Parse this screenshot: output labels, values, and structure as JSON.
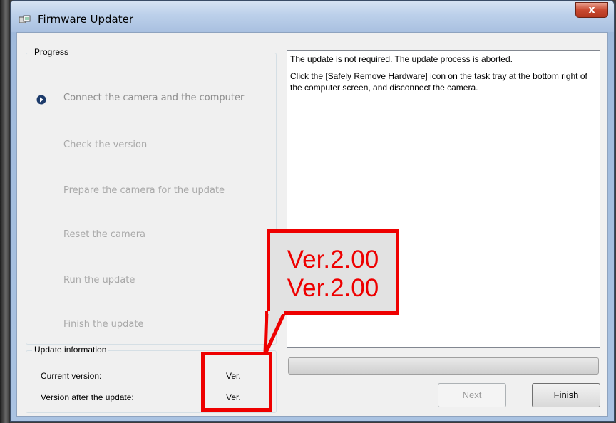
{
  "window": {
    "title": "Firmware Updater",
    "close_label": "x"
  },
  "progress": {
    "group_label": "Progress",
    "steps": [
      {
        "label": "Connect the camera and the computer",
        "active": true
      },
      {
        "label": "Check the version",
        "active": false
      },
      {
        "label": "Prepare the camera for the update",
        "active": false
      },
      {
        "label": "Reset the camera",
        "active": false
      },
      {
        "label": "Run the update",
        "active": false
      },
      {
        "label": "Finish the update",
        "active": false
      }
    ]
  },
  "update_info": {
    "group_label": "Update information",
    "current_version_label": "Current version:",
    "current_version_value": "Ver.",
    "after_version_label": "Version after the update:",
    "after_version_value": "Ver."
  },
  "message": {
    "line1": "The update is not required. The update process is aborted.",
    "line2": "Click the [Safely Remove Hardware] icon on the task tray at the bottom right of the computer screen, and disconnect the camera."
  },
  "progress_bar": {
    "fill_fraction": 0
  },
  "buttons": {
    "next_label": "Next",
    "finish_label": "Finish"
  },
  "annotation": {
    "current_version": "Ver.2.00",
    "after_version": "Ver.2.00"
  },
  "colors": {
    "annotation_red": "#ee0000",
    "active_step_bullet": "#1d3b6b"
  }
}
